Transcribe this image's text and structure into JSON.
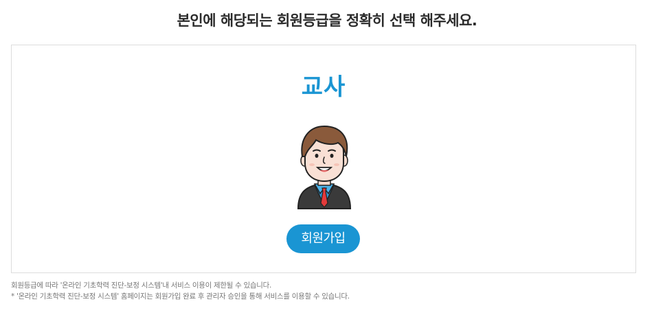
{
  "heading": "본인에 해당되는 회원등급을 정확히 선택 해주세요.",
  "card": {
    "role_title": "교사",
    "avatar_icon": "teacher-avatar-icon",
    "join_button_label": "회원가입"
  },
  "colors": {
    "accent": "#1a95d3",
    "heading_text": "#2b2b2b",
    "note_text": "#777777",
    "card_border": "#dcdcdc"
  },
  "notes": [
    "회원등급에 따라 '온라인 기초학력 진단-보정 시스템'내 서비스 이용이 제한될 수 있습니다.",
    "* '온라인 기초학력 진단-보정 시스템' 홈페이지는 회원가입 완료 후 관리자 승인을 통해 서비스를 이용할 수 있습니다."
  ]
}
